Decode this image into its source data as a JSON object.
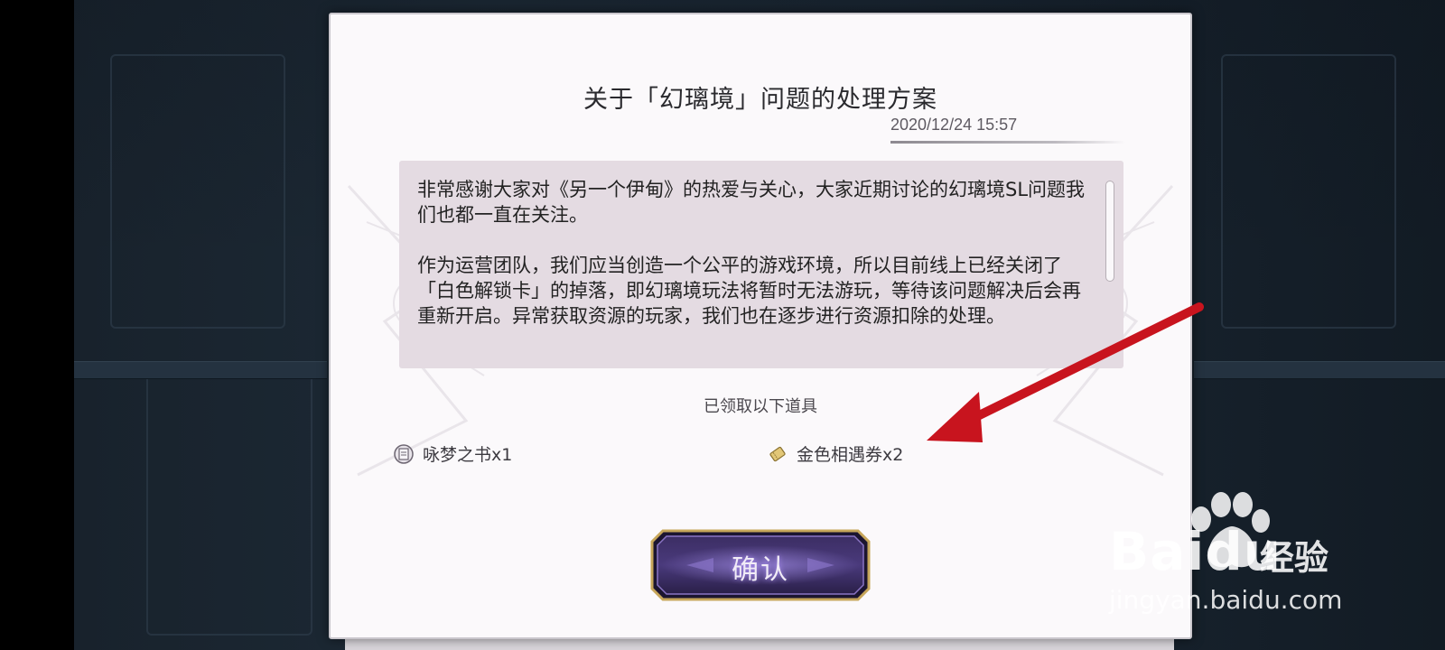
{
  "dialog": {
    "title": "关于「幻璃境」问题的处理方案",
    "timestamp": "2020/12/24 15:57",
    "paragraphs": [
      "非常感谢大家对《另一个伊甸》的热爱与关心，大家近期讨论的幻璃境SL问题我们也都一直在关注。",
      "作为运营团队，我们应当创造一个公平的游戏环境，所以目前线上已经关闭了「白色解锁卡」的掉落，即幻璃境玩法将暂时无法游玩，等待该问题解决后会再重新开启。异常获取资源的玩家，我们也在逐步进行资源扣除的处理。"
    ],
    "rewards_label": "已领取以下道具",
    "rewards": [
      {
        "name": "咏梦之书x1",
        "icon": "book-icon"
      },
      {
        "name": "金色相遇券x2",
        "icon": "gold-ticket-icon"
      }
    ],
    "confirm_label": "确认"
  },
  "watermark": {
    "brand": "Baidu",
    "brand_cn": "经验",
    "url": "jingyan.baidu.com"
  },
  "annotation": {
    "arrow_color": "#c8141e"
  }
}
